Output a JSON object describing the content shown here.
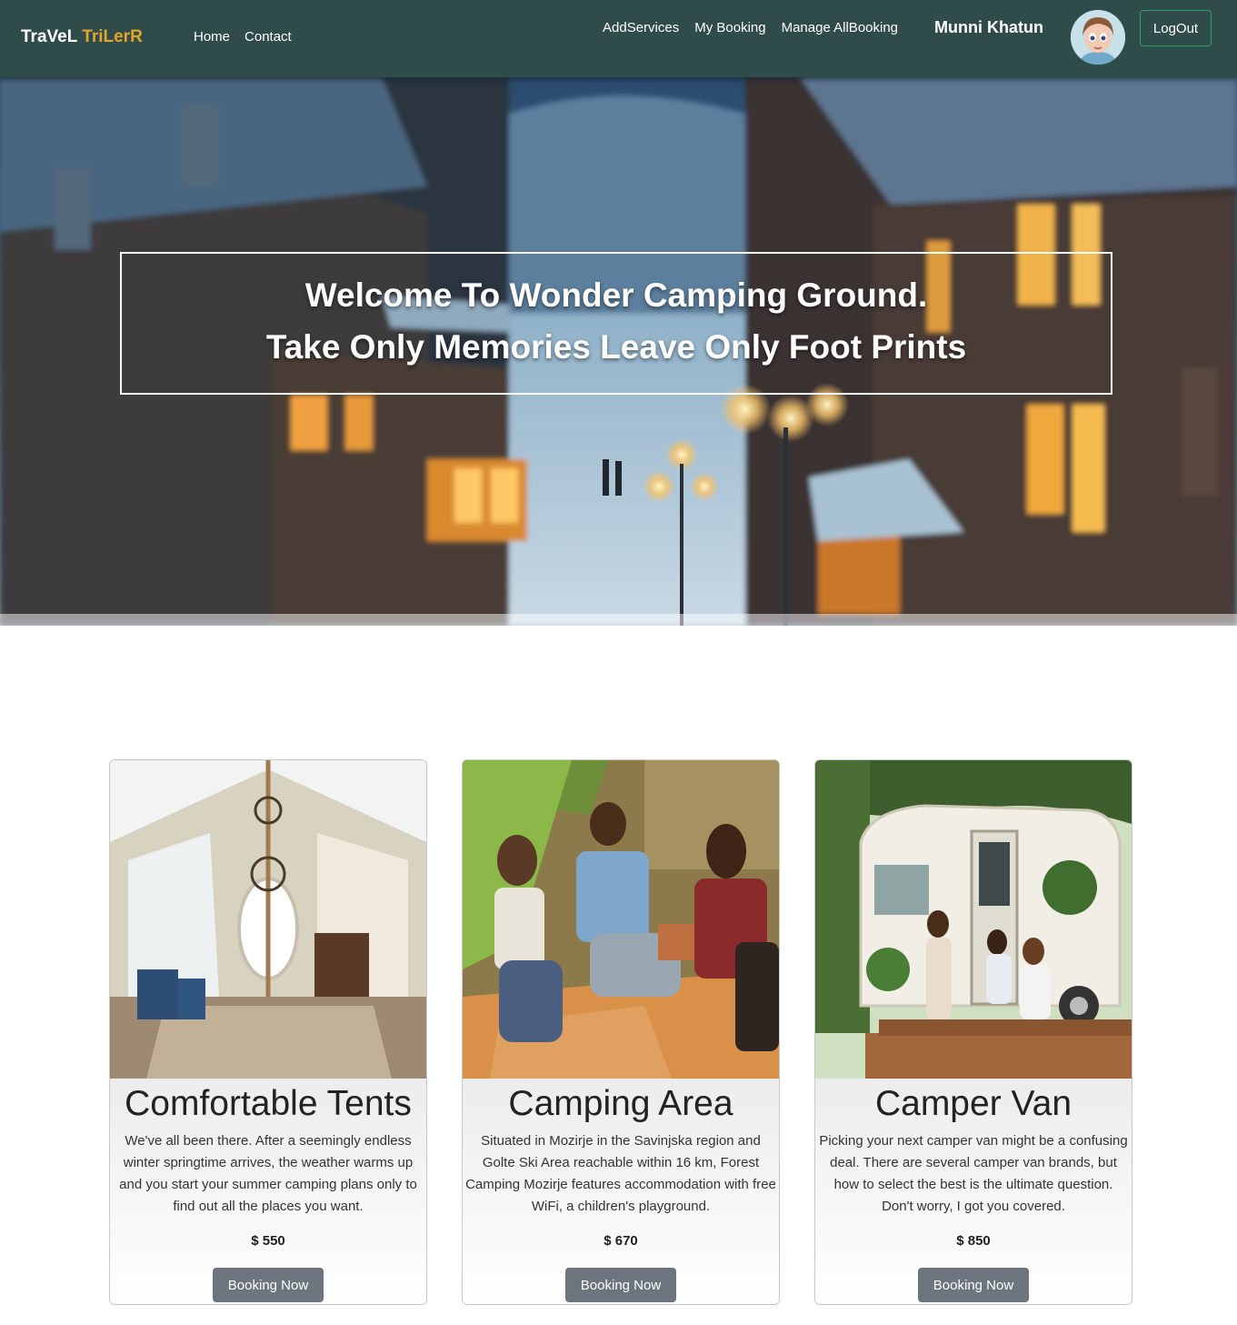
{
  "navbar": {
    "brand_part1": "TraVeL",
    "brand_part2": "TriLerR",
    "left_links": [
      "Home",
      "Contact"
    ],
    "right_links": [
      "AddServices",
      "My Booking",
      "Manage AllBooking"
    ],
    "user_name": "Munni Khatun",
    "logout_label": "LogOut",
    "colors": {
      "background": "#2f4b4a",
      "brand_accent": "#e3a52b",
      "logout_border": "#27a36a"
    }
  },
  "hero": {
    "line1": "Welcome To Wonder Camping Ground.",
    "line2": "Take Only Memories Leave Only Foot Prints"
  },
  "services": [
    {
      "title": "Comfortable Tents",
      "description": "We've all been there. After a seemingly endless winter springtime arrives, the weather warms up and you start your summer camping plans only to find out all the places you want.",
      "price": "$ 550",
      "button": "Booking Now"
    },
    {
      "title": "Camping Area",
      "description": "Situated in Mozirje in the Savinjska region and Golte Ski Area reachable within 16 km, Forest Camping Mozirje features accommodation with free WiFi, a children's playground.",
      "price": "$ 670",
      "button": "Booking Now"
    },
    {
      "title": "Camper Van",
      "description": "Picking your next camper van might be a confusing deal. There are several camper van brands, but how to select the best is the ultimate question. Don't worry, I got you covered.",
      "price": "$ 850",
      "button": "Booking Now"
    }
  ]
}
